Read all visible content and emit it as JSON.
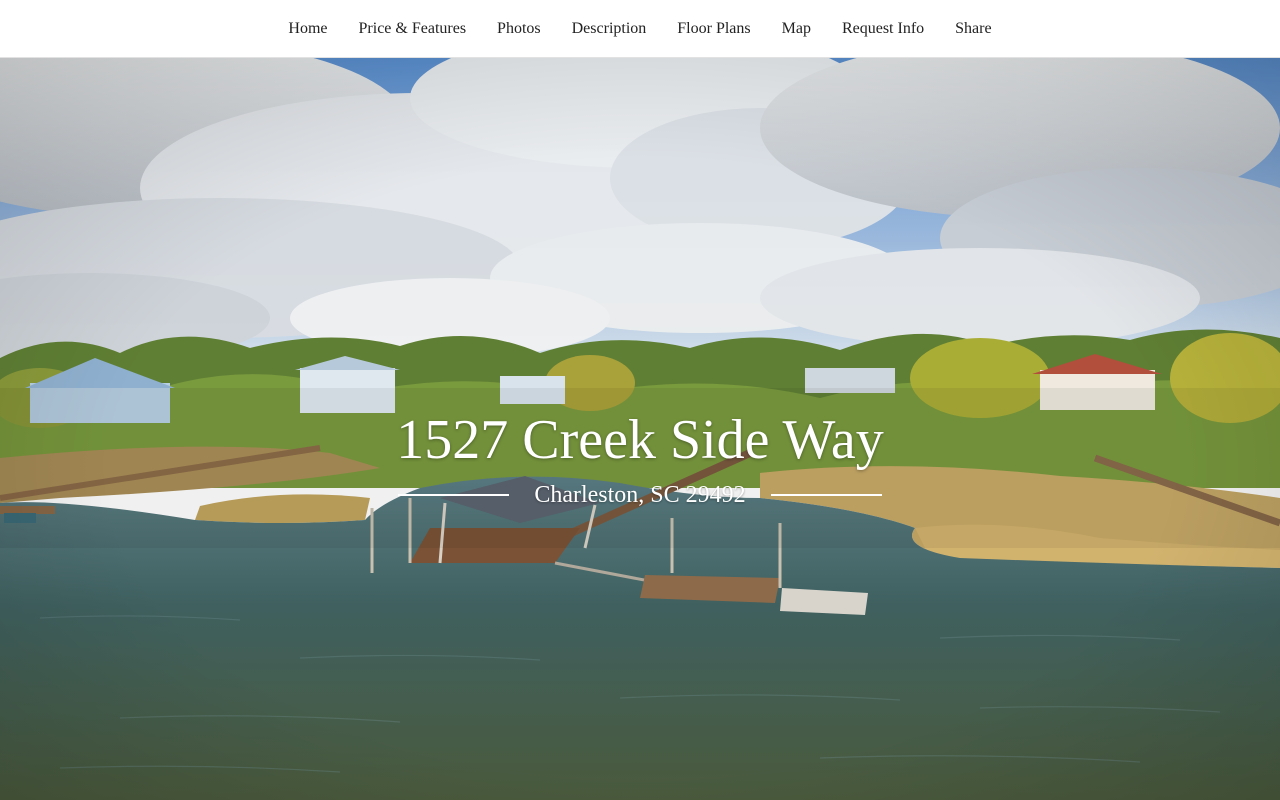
{
  "nav": {
    "items": [
      {
        "label": "Home"
      },
      {
        "label": "Price & Features"
      },
      {
        "label": "Photos"
      },
      {
        "label": "Description"
      },
      {
        "label": "Floor Plans"
      },
      {
        "label": "Map"
      },
      {
        "label": "Request Info"
      },
      {
        "label": "Share"
      }
    ]
  },
  "hero": {
    "address": "1527 Creek Side Way",
    "city_line": "Charleston, SC 29492",
    "image_subject": "aerial-marsh-dock-photo"
  },
  "colors": {
    "nav_text": "#222222",
    "hero_text": "#ffffff",
    "sky": "#4f86c9",
    "water": "#3d5a55",
    "marsh_grass": "#c9a763",
    "trees": "#6f8d3a"
  }
}
